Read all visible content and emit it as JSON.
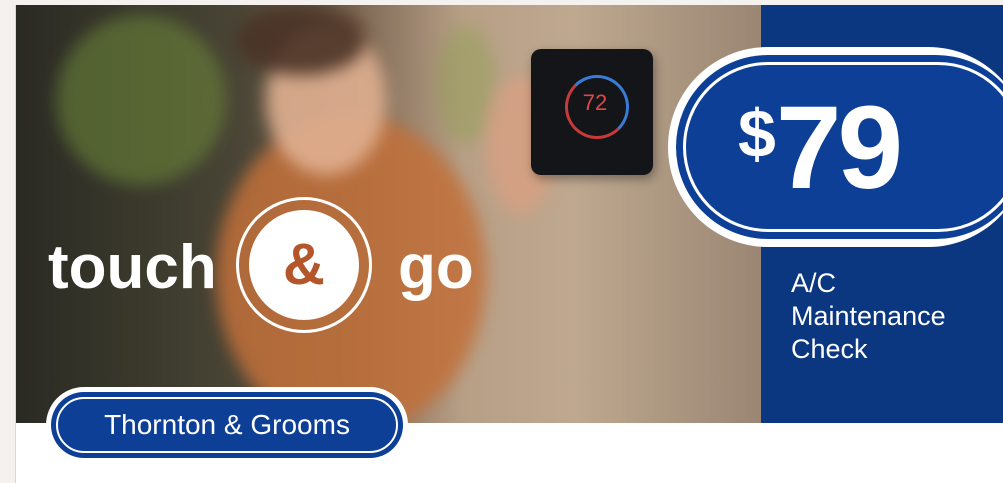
{
  "ad": {
    "logo_word_1": "touch",
    "logo_ampersand": "&",
    "logo_word_2": "go",
    "price": "79",
    "currency": "$",
    "service_lines": [
      "A/C",
      "Maintenance",
      "Check"
    ],
    "brand": "Thornton & Grooms",
    "thermostat_reading": "72"
  },
  "colors": {
    "brand_blue": "#0d3f96",
    "panel_blue": "#0b3680",
    "ampersand_orange": "#b4552a",
    "white": "#ffffff"
  }
}
